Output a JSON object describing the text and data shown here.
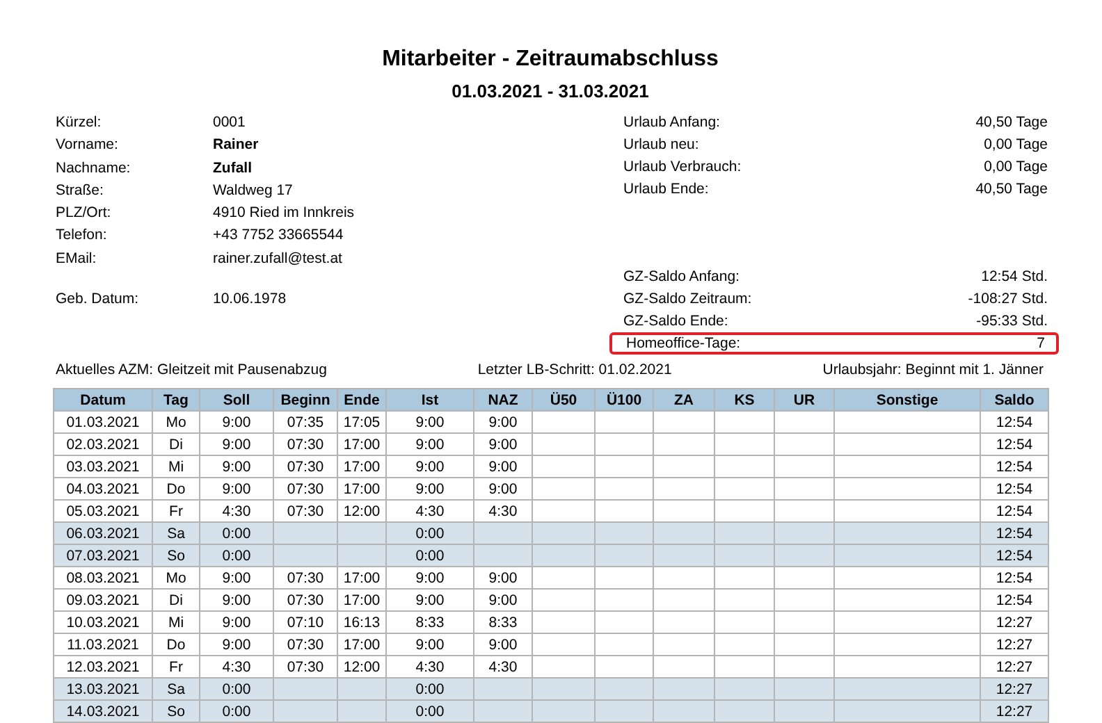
{
  "title": "Mitarbeiter - Zeitraumabschluss",
  "period": "01.03.2021 - 31.03.2021",
  "personal": [
    {
      "label": "Kürzel:",
      "value": "0001",
      "bold": false
    },
    {
      "label": "Vorname:",
      "value": "Rainer",
      "bold": true
    },
    {
      "label": "Nachname:",
      "value": "Zufall",
      "bold": true
    },
    {
      "label": "Straße:",
      "value": "Waldweg 17",
      "bold": false
    },
    {
      "label": "PLZ/Ort:",
      "value": "4910 Ried im Innkreis",
      "bold": false
    },
    {
      "label": "Telefon:",
      "value": "+43 7752 33665544",
      "bold": false
    },
    {
      "label": "EMail:",
      "value": "rainer.zufall@test.at",
      "bold": false
    }
  ],
  "birth": {
    "label": "Geb. Datum:",
    "value": "10.06.1978"
  },
  "vacation": [
    {
      "label": "Urlaub Anfang:",
      "value": "40,50 Tage"
    },
    {
      "label": "Urlaub neu:",
      "value": "0,00 Tage"
    },
    {
      "label": "Urlaub Verbrauch:",
      "value": "0,00 Tage"
    },
    {
      "label": "Urlaub Ende:",
      "value": "40,50 Tage"
    }
  ],
  "balance": [
    {
      "label": "GZ-Saldo Anfang:",
      "value": "12:54 Std.",
      "highlighted": false
    },
    {
      "label": "GZ-Saldo Zeitraum:",
      "value": "-108:27 Std.",
      "highlighted": false
    },
    {
      "label": "GZ-Saldo Ende:",
      "value": "-95:33 Std.",
      "highlighted": false
    },
    {
      "label": "Homeoffice-Tage:",
      "value": "7",
      "highlighted": true
    }
  ],
  "info_line": [
    "Aktuelles AZM: Gleitzeit mit Pausenabzug",
    "Letzter LB-Schritt: 01.02.2021",
    "Urlaubsjahr: Beginnt mit 1. Jänner"
  ],
  "table": {
    "columns": [
      "Datum",
      "Tag",
      "Soll",
      "Beginn",
      "Ende",
      "Ist",
      "NAZ",
      "Ü50",
      "Ü100",
      "ZA",
      "KS",
      "UR",
      "Sonstige",
      "Saldo"
    ],
    "rows": [
      {
        "weekend": false,
        "cells": [
          "01.03.2021",
          "Mo",
          "9:00",
          "07:35",
          "17:05",
          "9:00",
          "9:00",
          "",
          "",
          "",
          "",
          "",
          "",
          "12:54"
        ]
      },
      {
        "weekend": false,
        "cells": [
          "02.03.2021",
          "Di",
          "9:00",
          "07:30",
          "17:00",
          "9:00",
          "9:00",
          "",
          "",
          "",
          "",
          "",
          "",
          "12:54"
        ]
      },
      {
        "weekend": false,
        "cells": [
          "03.03.2021",
          "Mi",
          "9:00",
          "07:30",
          "17:00",
          "9:00",
          "9:00",
          "",
          "",
          "",
          "",
          "",
          "",
          "12:54"
        ]
      },
      {
        "weekend": false,
        "cells": [
          "04.03.2021",
          "Do",
          "9:00",
          "07:30",
          "17:00",
          "9:00",
          "9:00",
          "",
          "",
          "",
          "",
          "",
          "",
          "12:54"
        ]
      },
      {
        "weekend": false,
        "cells": [
          "05.03.2021",
          "Fr",
          "4:30",
          "07:30",
          "12:00",
          "4:30",
          "4:30",
          "",
          "",
          "",
          "",
          "",
          "",
          "12:54"
        ]
      },
      {
        "weekend": true,
        "cells": [
          "06.03.2021",
          "Sa",
          "0:00",
          "",
          "",
          "0:00",
          "",
          "",
          "",
          "",
          "",
          "",
          "",
          "12:54"
        ]
      },
      {
        "weekend": true,
        "cells": [
          "07.03.2021",
          "So",
          "0:00",
          "",
          "",
          "0:00",
          "",
          "",
          "",
          "",
          "",
          "",
          "",
          "12:54"
        ]
      },
      {
        "weekend": false,
        "cells": [
          "08.03.2021",
          "Mo",
          "9:00",
          "07:30",
          "17:00",
          "9:00",
          "9:00",
          "",
          "",
          "",
          "",
          "",
          "",
          "12:54"
        ]
      },
      {
        "weekend": false,
        "cells": [
          "09.03.2021",
          "Di",
          "9:00",
          "07:30",
          "17:00",
          "9:00",
          "9:00",
          "",
          "",
          "",
          "",
          "",
          "",
          "12:54"
        ]
      },
      {
        "weekend": false,
        "cells": [
          "10.03.2021",
          "Mi",
          "9:00",
          "07:10",
          "16:13",
          "8:33",
          "8:33",
          "",
          "",
          "",
          "",
          "",
          "",
          "12:27"
        ]
      },
      {
        "weekend": false,
        "cells": [
          "11.03.2021",
          "Do",
          "9:00",
          "07:30",
          "17:00",
          "9:00",
          "9:00",
          "",
          "",
          "",
          "",
          "",
          "",
          "12:27"
        ]
      },
      {
        "weekend": false,
        "cells": [
          "12.03.2021",
          "Fr",
          "4:30",
          "07:30",
          "12:00",
          "4:30",
          "4:30",
          "",
          "",
          "",
          "",
          "",
          "",
          "12:27"
        ]
      },
      {
        "weekend": true,
        "cells": [
          "13.03.2021",
          "Sa",
          "0:00",
          "",
          "",
          "0:00",
          "",
          "",
          "",
          "",
          "",
          "",
          "",
          "12:27"
        ]
      },
      {
        "weekend": true,
        "cells": [
          "14.03.2021",
          "So",
          "0:00",
          "",
          "",
          "0:00",
          "",
          "",
          "",
          "",
          "",
          "",
          "",
          "12:27"
        ]
      }
    ]
  }
}
